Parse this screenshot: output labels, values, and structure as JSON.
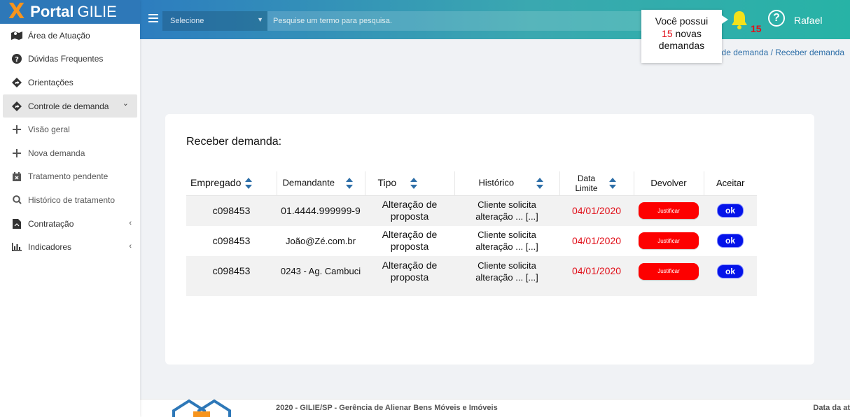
{
  "brand": {
    "x": "X",
    "bold": "Portal",
    "name": "GILIE"
  },
  "sidebar": {
    "items": [
      {
        "label": "Área de Atuação"
      },
      {
        "label": "Dúvidas Frequentes"
      },
      {
        "label": "Orientações"
      },
      {
        "label": "Controle de demanda"
      },
      {
        "label": "Visão geral"
      },
      {
        "label": "Nova demanda"
      },
      {
        "label": "Tratamento pendente"
      },
      {
        "label": "Histórico de tratamento"
      },
      {
        "label": "Contratação"
      },
      {
        "label": "Indicadores"
      }
    ]
  },
  "header": {
    "select_label": "Selecione",
    "search_placeholder": "Pesquise um termo para pesquisa.",
    "badge_count": "15",
    "help": "?",
    "user": "Rafael"
  },
  "tooltip": {
    "line1": "Você possui",
    "count": "15",
    "line2": "novas",
    "line3": "demandas"
  },
  "breadcrumb": "e de demanda / Receber demanda",
  "main": {
    "title": "Receber demanda:",
    "columns": [
      "Empregado",
      "Demandante",
      "Tipo",
      "Histórico",
      "Data",
      "Limite",
      "Devolver",
      "Aceitar"
    ],
    "rows": [
      {
        "empregado": "c098453",
        "demandante": "01.4444.999999-9",
        "tipo1": "Alteração de",
        "tipo2": "proposta",
        "hist1": "Cliente solicita",
        "hist2": "alteração ... [...]",
        "data": "04/01/2020",
        "justificar": "Justificar",
        "ok": "ok"
      },
      {
        "empregado": "c098453",
        "demandante": "João@Zé.com.br",
        "tipo1": "Alteração de",
        "tipo2": "proposta",
        "hist1": "Cliente solicita",
        "hist2": "alteração ... [...]",
        "data": "04/01/2020",
        "justificar": "Justificar",
        "ok": "ok"
      },
      {
        "empregado": "c098453",
        "demandante": "0243 - Ag. Cambuci",
        "tipo1": "Alteração de",
        "tipo2": "proposta",
        "hist1": "Cliente solicita",
        "hist2": "alteração ... [...]",
        "data": "04/01/2020",
        "justificar": "Justificar",
        "ok": "ok"
      }
    ]
  },
  "footer": {
    "text": "2020 - GILIE/SP - Gerência de Alienar Bens Móveis e Imóveis",
    "right": "Data da at"
  },
  "colors": {
    "brand_blue": "#2e78b8",
    "accent_orange": "#f7941d",
    "danger": "#fd0000",
    "ok_blue": "#0413e9",
    "date_red": "#e1101a"
  }
}
